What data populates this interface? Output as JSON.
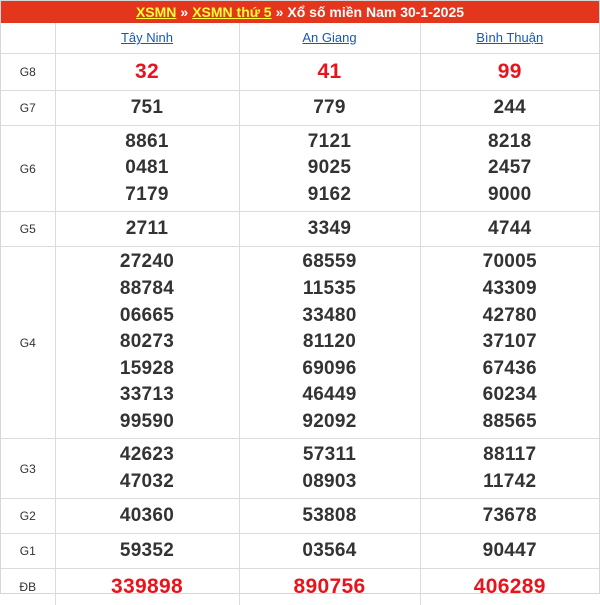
{
  "breadcrumb": {
    "link1": "XSMN",
    "link2": "XSMN thứ 5",
    "separator": "»",
    "title": "Xổ số miền Nam 30-1-2025"
  },
  "provinces": [
    "Tây Ninh",
    "An Giang",
    "Bình Thuận"
  ],
  "rows": [
    {
      "prize": "G8",
      "values": [
        [
          "32"
        ],
        [
          "41"
        ],
        [
          "99"
        ]
      ]
    },
    {
      "prize": "G7",
      "values": [
        [
          "751"
        ],
        [
          "779"
        ],
        [
          "244"
        ]
      ]
    },
    {
      "prize": "G6",
      "values": [
        [
          "8861",
          "0481",
          "7179"
        ],
        [
          "7121",
          "9025",
          "9162"
        ],
        [
          "8218",
          "2457",
          "9000"
        ]
      ]
    },
    {
      "prize": "G5",
      "values": [
        [
          "2711"
        ],
        [
          "3349"
        ],
        [
          "4744"
        ]
      ]
    },
    {
      "prize": "G4",
      "values": [
        [
          "27240",
          "88784",
          "06665",
          "80273",
          "15928",
          "33713",
          "99590"
        ],
        [
          "68559",
          "11535",
          "33480",
          "81120",
          "69096",
          "46449",
          "92092"
        ],
        [
          "70005",
          "43309",
          "42780",
          "37107",
          "67436",
          "60234",
          "88565"
        ]
      ]
    },
    {
      "prize": "G3",
      "values": [
        [
          "42623",
          "47032"
        ],
        [
          "57311",
          "08903"
        ],
        [
          "88117",
          "11742"
        ]
      ]
    },
    {
      "prize": "G2",
      "values": [
        [
          "40360"
        ],
        [
          "53808"
        ],
        [
          "73678"
        ]
      ]
    },
    {
      "prize": "G1",
      "values": [
        [
          "59352"
        ],
        [
          "03564"
        ],
        [
          "90447"
        ]
      ]
    },
    {
      "prize": "ĐB",
      "values": [
        [
          "339898"
        ],
        [
          "890756"
        ],
        [
          "406289"
        ]
      ]
    }
  ],
  "colors": {
    "title_bg": "#e3361c",
    "title_link": "#ffff33",
    "province_link": "#1559b5",
    "highlight_number": "#e8141c",
    "number": "#333333"
  }
}
